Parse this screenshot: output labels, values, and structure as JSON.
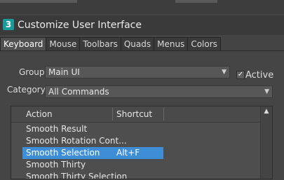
{
  "window": {
    "title": "Customize User Interface",
    "app_icon_label": "3"
  },
  "tabs": [
    {
      "label": "Keyboard",
      "active": true
    },
    {
      "label": "Mouse",
      "active": false
    },
    {
      "label": "Toolbars",
      "active": false
    },
    {
      "label": "Quads",
      "active": false
    },
    {
      "label": "Menus",
      "active": false
    },
    {
      "label": "Colors",
      "active": false
    }
  ],
  "filters": {
    "group_label": "Group:",
    "group_value": "Main UI",
    "active_label": "Active",
    "active_checked": true,
    "category_label": "Category:",
    "category_value": "All Commands"
  },
  "list": {
    "columns": [
      "Action",
      "Shortcut"
    ],
    "rows": [
      {
        "action": "Smooth Result",
        "shortcut": "",
        "selected": false
      },
      {
        "action": "Smooth Rotation Cont...",
        "shortcut": "",
        "selected": false
      },
      {
        "action": "Smooth Selection",
        "shortcut": "Alt+F",
        "selected": true
      },
      {
        "action": "Smooth Thirty",
        "shortcut": "",
        "selected": false
      },
      {
        "action": "Smooth Thirty Selection",
        "shortcut": "",
        "selected": false
      }
    ]
  },
  "colors": {
    "accent": "#3d8ed6",
    "background": "#444444"
  }
}
